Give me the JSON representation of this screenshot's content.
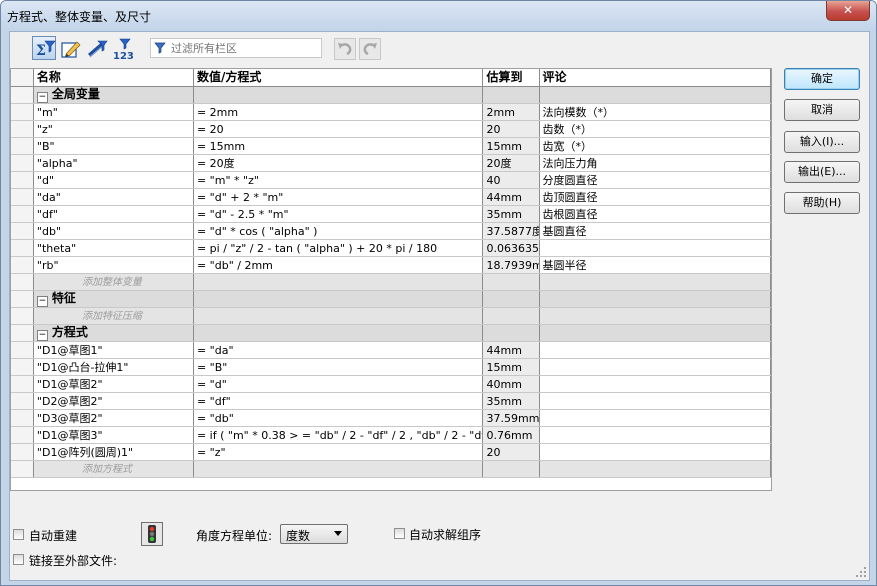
{
  "window": {
    "title": "方程式、整体变量、及尺寸",
    "close_label": "✕"
  },
  "toolbar": {
    "filter_placeholder": "过滤所有栏区",
    "buttons": [
      "equation-view",
      "sketch-equation-view",
      "dimension-view",
      "ordered-view"
    ]
  },
  "grid": {
    "columns": [
      "名称",
      "数值/方程式",
      "估算到",
      "评论"
    ],
    "sections": [
      {
        "title": "全局变量",
        "toggle": "−",
        "rows": [
          {
            "name": "\"m\"",
            "value": "= 2mm",
            "est": "2mm",
            "comment": "法向模数（*）"
          },
          {
            "name": "\"z\"",
            "value": "= 20",
            "est": "20",
            "comment": "齿数（*）"
          },
          {
            "name": "\"B\"",
            "value": "= 15mm",
            "est": "15mm",
            "comment": "齿宽（*）"
          },
          {
            "name": "\"alpha\"",
            "value": "= 20度",
            "est": "20度",
            "comment": "法向压力角"
          },
          {
            "name": "\"d\"",
            "value": "= \"m\" * \"z\"",
            "est": "40",
            "comment": "分度圆直径"
          },
          {
            "name": "\"da\"",
            "value": "= \"d\" + 2 * \"m\"",
            "est": "44mm",
            "comment": "齿顶圆直径"
          },
          {
            "name": "\"df\"",
            "value": "= \"d\" - 2.5 * \"m\"",
            "est": "35mm",
            "comment": "齿根圆直径"
          },
          {
            "name": "\"db\"",
            "value": "= \"d\" * cos ( \"alpha\" )",
            "est": "37.5877度",
            "comment": "基圆直径"
          },
          {
            "name": "\"theta\"",
            "value": "= pi / \"z\" / 2 - tan ( \"alpha\" ) + 20 * pi / 180",
            "est": "0.0636354",
            "comment": ""
          },
          {
            "name": "\"rb\"",
            "value": "= \"db\" / 2mm",
            "est": "18.7939m",
            "comment": "基圆半径"
          }
        ],
        "add_label": "添加整体变量"
      },
      {
        "title": "特征",
        "toggle": "−",
        "rows": [],
        "add_label": "添加特征压缩"
      },
      {
        "title": "方程式",
        "toggle": "−",
        "rows": [
          {
            "name": "\"D1@草图1\"",
            "value": "= \"da\"",
            "est": "44mm",
            "comment": ""
          },
          {
            "name": "\"D1@凸台-拉伸1\"",
            "value": "= \"B\"",
            "est": "15mm",
            "comment": ""
          },
          {
            "name": "\"D1@草图2\"",
            "value": "= \"d\"",
            "est": "40mm",
            "comment": ""
          },
          {
            "name": "\"D2@草图2\"",
            "value": "= \"df\"",
            "est": "35mm",
            "comment": ""
          },
          {
            "name": "\"D3@草图2\"",
            "value": "= \"db\"",
            "est": "37.59mm",
            "comment": ""
          },
          {
            "name": "\"D1@草图3\"",
            "value": "= if ( \"m\" * 0.38 > = \"db\" / 2 - \"df\" / 2 , \"db\" / 2 - \"df\" / 2 ,",
            "est": "0.76mm",
            "comment": ""
          },
          {
            "name": "\"D1@阵列(圆周)1\"",
            "value": "= \"z\"",
            "est": "20",
            "comment": ""
          }
        ],
        "add_label": "添加方程式"
      }
    ]
  },
  "buttons": {
    "ok": "确定",
    "cancel": "取消",
    "import": "输入(I)...",
    "export": "输出(E)...",
    "help": "帮助(H)"
  },
  "bottom": {
    "auto_rebuild": "自动重建",
    "angle_unit_label": "角度方程单位:",
    "angle_unit_value": "度数",
    "auto_solve": "自动求解组序",
    "link_external": "链接至外部文件:"
  },
  "colors": {
    "accent": "#3c7fb1",
    "section_bg": "#dcdcdc",
    "titlebar": "#c4d5ea"
  }
}
